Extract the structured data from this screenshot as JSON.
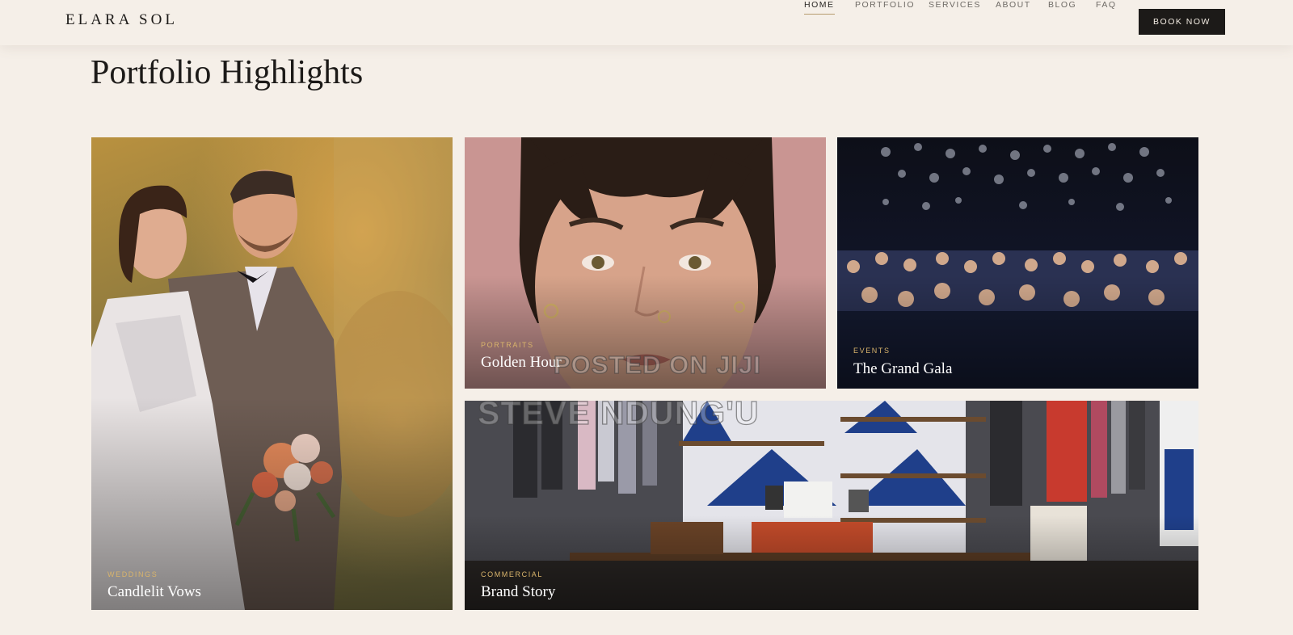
{
  "brand": {
    "logo": "ELARA SOL"
  },
  "nav": {
    "items": [
      {
        "label": "HOME",
        "active": true
      },
      {
        "label": "PORTFOLIO",
        "active": false
      },
      {
        "label": "SERVICES",
        "active": false
      },
      {
        "label": "ABOUT",
        "active": false
      },
      {
        "label": "BLOG",
        "active": false
      },
      {
        "label": "FAQ",
        "active": false
      }
    ],
    "cta": "BOOK NOW"
  },
  "page": {
    "title": "Portfolio Highlights"
  },
  "portfolio": [
    {
      "category": "WEDDINGS",
      "title": "Candlelit Vows"
    },
    {
      "category": "PORTRAITS",
      "title": "Golden Hour"
    },
    {
      "category": "EVENTS",
      "title": "The Grand Gala"
    },
    {
      "category": "COMMERCIAL",
      "title": "Brand Story"
    }
  ],
  "watermarks": {
    "line1": "POSTED ON JIJI",
    "line2": "STEVE NDUNG'U"
  },
  "colors": {
    "background": "#f5efe8",
    "accent_gold": "#d9b46b",
    "button": "#1c1a18"
  }
}
